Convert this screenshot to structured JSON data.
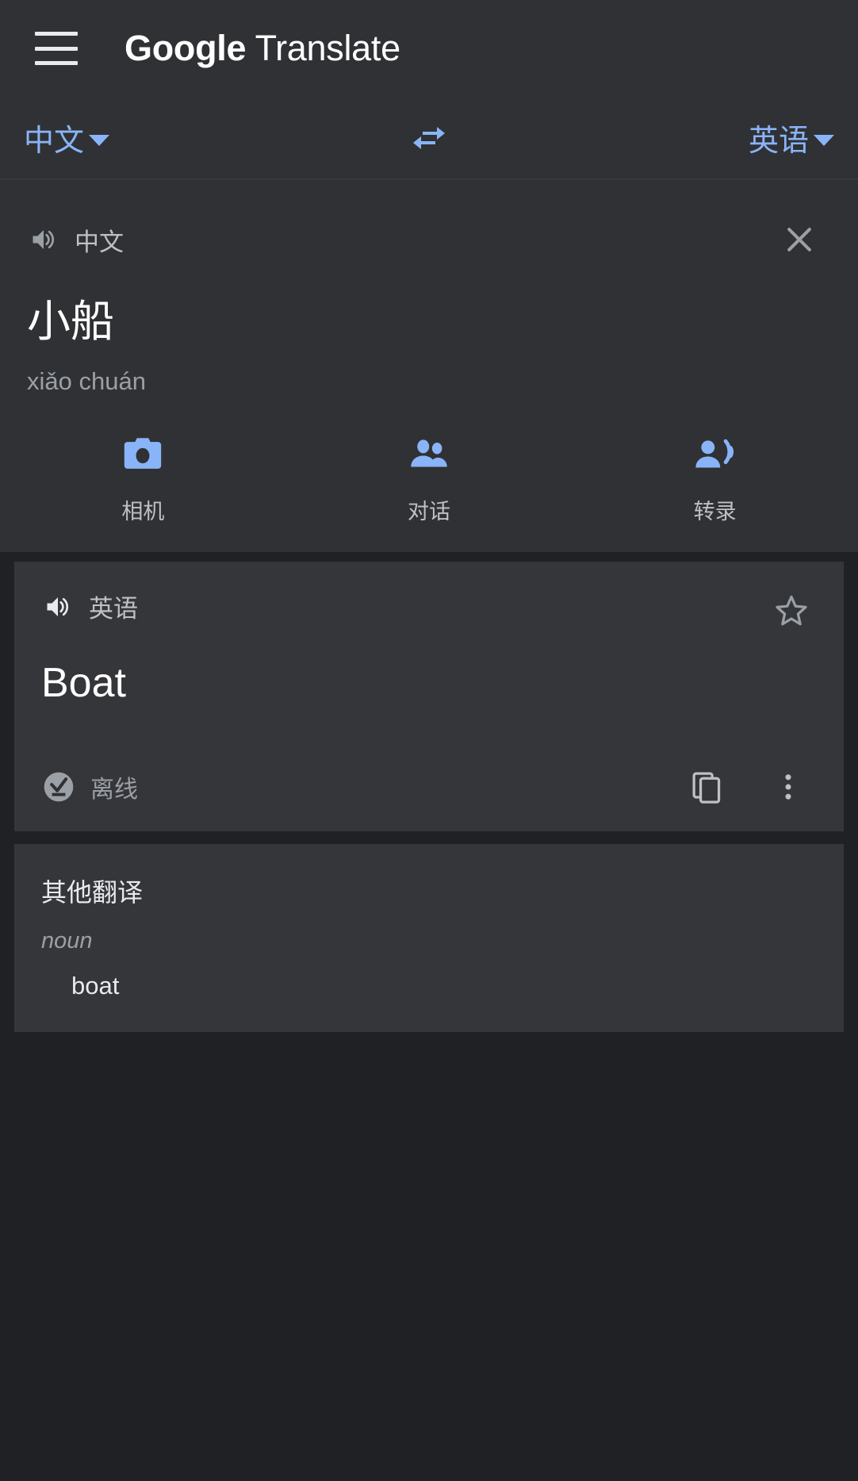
{
  "header": {
    "menu_icon": "hamburger-menu-icon",
    "title_brand": "Google",
    "title_product": " Translate"
  },
  "language_bar": {
    "source_language": "中文",
    "target_language": "英语",
    "swap_icon": "swap-horizontal-icon",
    "caret_icon": "caret-down-icon",
    "accent_color": "#8ab4f8"
  },
  "source_panel": {
    "speaker_icon": "volume-up-icon",
    "language_label": "中文",
    "close_icon": "close-icon",
    "text": "小船",
    "romanization": "xiǎo chuán"
  },
  "actions": [
    {
      "icon": "camera-icon",
      "label": "相机"
    },
    {
      "icon": "people-icon",
      "label": "对话"
    },
    {
      "icon": "record-voice-over-icon",
      "label": "转录"
    }
  ],
  "result_card": {
    "speaker_icon": "volume-up-icon",
    "language_label": "英语",
    "star_icon": "star-outline-icon",
    "text": "Boat",
    "offline_icon": "offline-download-done-icon",
    "offline_label": "离线",
    "copy_icon": "copy-icon",
    "more_icon": "more-vertical-icon"
  },
  "other_translations": {
    "title": "其他翻译",
    "entries": [
      {
        "part_of_speech": "noun",
        "word": "boat"
      }
    ]
  },
  "theme": {
    "page_background": "#202124",
    "surface": "#303134",
    "card_surface": "#35363a",
    "primary_text": "#ffffff",
    "secondary_text": "#9aa0a6",
    "accent": "#8ab4f8"
  }
}
